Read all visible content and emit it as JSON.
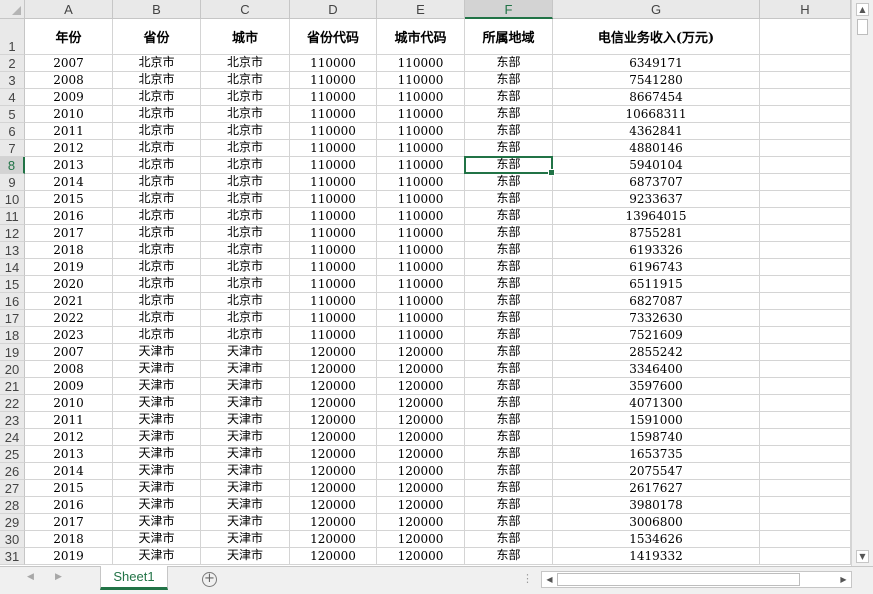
{
  "sheet": {
    "columns": [
      "A",
      "B",
      "C",
      "D",
      "E",
      "F",
      "G",
      "H"
    ],
    "selected_column": "F",
    "selected_row": 8,
    "header_row": [
      "年份",
      "省份",
      "城市",
      "省份代码",
      "城市代码",
      "所属地域",
      "电信业务收入(万元)",
      ""
    ],
    "rows": [
      [
        "2007",
        "北京市",
        "北京市",
        "110000",
        "110000",
        "东部",
        "6349171"
      ],
      [
        "2008",
        "北京市",
        "北京市",
        "110000",
        "110000",
        "东部",
        "7541280"
      ],
      [
        "2009",
        "北京市",
        "北京市",
        "110000",
        "110000",
        "东部",
        "8667454"
      ],
      [
        "2010",
        "北京市",
        "北京市",
        "110000",
        "110000",
        "东部",
        "10668311"
      ],
      [
        "2011",
        "北京市",
        "北京市",
        "110000",
        "110000",
        "东部",
        "4362841"
      ],
      [
        "2012",
        "北京市",
        "北京市",
        "110000",
        "110000",
        "东部",
        "4880146"
      ],
      [
        "2013",
        "北京市",
        "北京市",
        "110000",
        "110000",
        "东部",
        "5940104"
      ],
      [
        "2014",
        "北京市",
        "北京市",
        "110000",
        "110000",
        "东部",
        "6873707"
      ],
      [
        "2015",
        "北京市",
        "北京市",
        "110000",
        "110000",
        "东部",
        "9233637"
      ],
      [
        "2016",
        "北京市",
        "北京市",
        "110000",
        "110000",
        "东部",
        "13964015"
      ],
      [
        "2017",
        "北京市",
        "北京市",
        "110000",
        "110000",
        "东部",
        "8755281"
      ],
      [
        "2018",
        "北京市",
        "北京市",
        "110000",
        "110000",
        "东部",
        "6193326"
      ],
      [
        "2019",
        "北京市",
        "北京市",
        "110000",
        "110000",
        "东部",
        "6196743"
      ],
      [
        "2020",
        "北京市",
        "北京市",
        "110000",
        "110000",
        "东部",
        "6511915"
      ],
      [
        "2021",
        "北京市",
        "北京市",
        "110000",
        "110000",
        "东部",
        "6827087"
      ],
      [
        "2022",
        "北京市",
        "北京市",
        "110000",
        "110000",
        "东部",
        "7332630"
      ],
      [
        "2023",
        "北京市",
        "北京市",
        "110000",
        "110000",
        "东部",
        "7521609"
      ],
      [
        "2007",
        "天津市",
        "天津市",
        "120000",
        "120000",
        "东部",
        "2855242"
      ],
      [
        "2008",
        "天津市",
        "天津市",
        "120000",
        "120000",
        "东部",
        "3346400"
      ],
      [
        "2009",
        "天津市",
        "天津市",
        "120000",
        "120000",
        "东部",
        "3597600"
      ],
      [
        "2010",
        "天津市",
        "天津市",
        "120000",
        "120000",
        "东部",
        "4071300"
      ],
      [
        "2011",
        "天津市",
        "天津市",
        "120000",
        "120000",
        "东部",
        "1591000"
      ],
      [
        "2012",
        "天津市",
        "天津市",
        "120000",
        "120000",
        "东部",
        "1598740"
      ],
      [
        "2013",
        "天津市",
        "天津市",
        "120000",
        "120000",
        "东部",
        "1653735"
      ],
      [
        "2014",
        "天津市",
        "天津市",
        "120000",
        "120000",
        "东部",
        "2075547"
      ],
      [
        "2015",
        "天津市",
        "天津市",
        "120000",
        "120000",
        "东部",
        "2617627"
      ],
      [
        "2016",
        "天津市",
        "天津市",
        "120000",
        "120000",
        "东部",
        "3980178"
      ],
      [
        "2017",
        "天津市",
        "天津市",
        "120000",
        "120000",
        "东部",
        "3006800"
      ],
      [
        "2018",
        "天津市",
        "天津市",
        "120000",
        "120000",
        "东部",
        "1534626"
      ],
      [
        "2019",
        "天津市",
        "天津市",
        "120000",
        "120000",
        "东部",
        "1419332"
      ]
    ]
  },
  "tabs": {
    "sheet_name": "Sheet1",
    "add_sheet_symbol": "+",
    "prev_symbol": "◀",
    "next_symbol": "▶",
    "split_symbol": "⋮"
  },
  "scrollbars": {
    "up_symbol": "▲",
    "down_symbol": "▼",
    "left_symbol": "◀",
    "right_symbol": "▶"
  },
  "colors": {
    "accent": "#217346",
    "header_bg": "#e9e9e9",
    "gridline": "#d4d4d4"
  }
}
